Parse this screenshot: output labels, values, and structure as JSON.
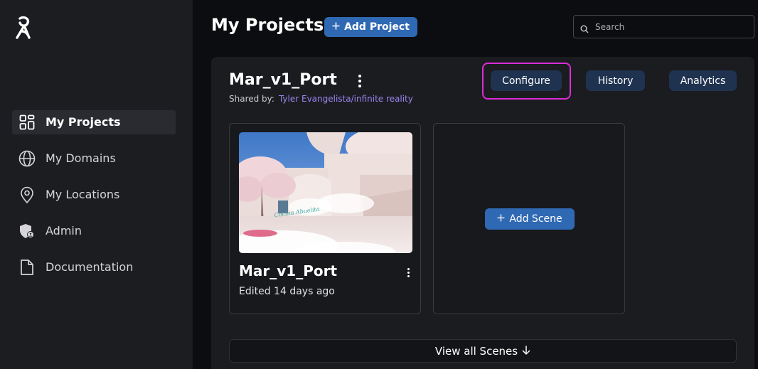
{
  "sidebar": {
    "items": [
      {
        "label": "My Projects",
        "icon": "grid-icon",
        "active": true
      },
      {
        "label": "My Domains",
        "icon": "globe-icon",
        "active": false
      },
      {
        "label": "My Locations",
        "icon": "map-pin-icon",
        "active": false
      },
      {
        "label": "Admin",
        "icon": "shield-user-icon",
        "active": false
      },
      {
        "label": "Documentation",
        "icon": "document-icon",
        "active": false
      }
    ]
  },
  "header": {
    "title": "My Projects",
    "add_project_label": "Add Project",
    "search_placeholder": "Search"
  },
  "project": {
    "name": "Mar_v1_Port",
    "shared_by_label": "Shared by:",
    "shared_by_user": "Tyler Evangelista/infinite reality",
    "tabs": [
      "Configure",
      "History",
      "Analytics"
    ],
    "highlighted_tab": "Configure"
  },
  "scenes": [
    {
      "name": "Mar_v1_Port",
      "edited": "Edited 14 days ago",
      "thumb_sign_text": "Cocina Abuelita"
    }
  ],
  "add_scene_label": "Add Scene",
  "view_all_label": "View all Scenes",
  "colors": {
    "primary_button": "#2f69b3",
    "tab_button": "#1f3350",
    "highlight_ring": "#dd2bd8",
    "link": "#9a84f0",
    "sidebar_bg": "#1c1d21",
    "page_bg": "#0c0d10"
  }
}
